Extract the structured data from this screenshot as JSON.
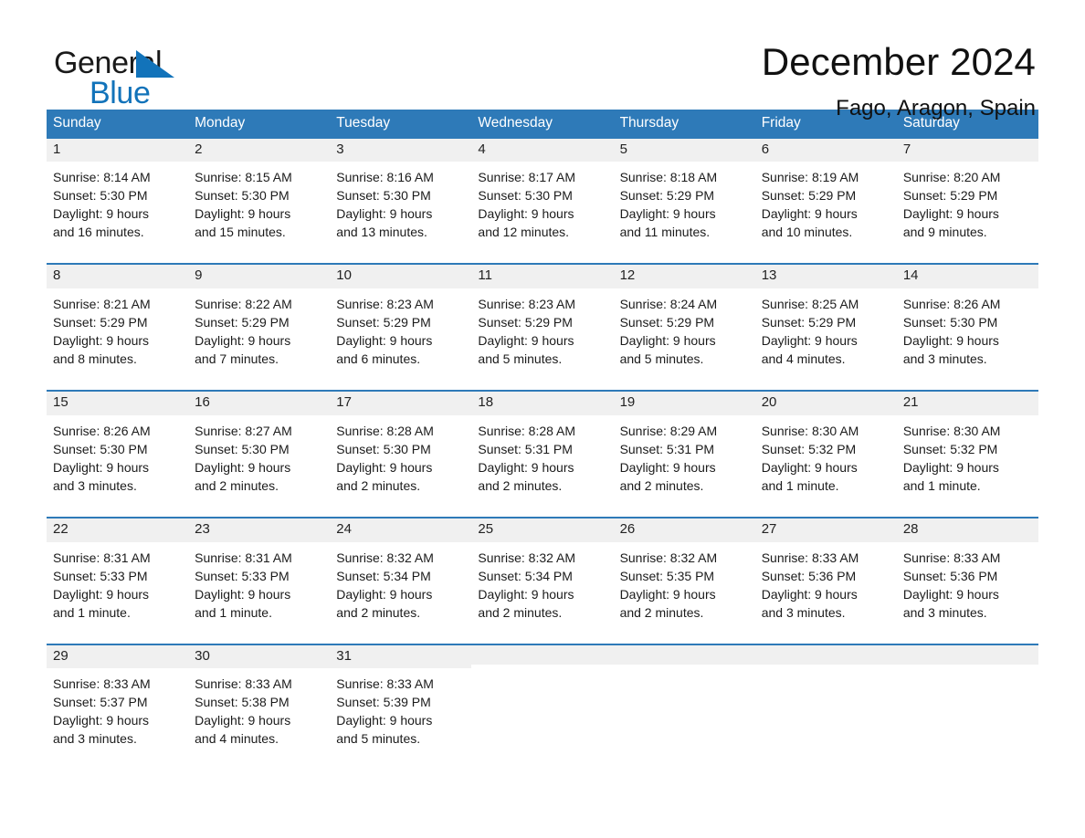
{
  "brand": {
    "word_general": "General",
    "word_blue": "Blue",
    "triangle_color": "#1273ba",
    "blue_text_color": "#1273ba"
  },
  "header": {
    "month_title": "December 2024",
    "location": "Fago, Aragon, Spain"
  },
  "theme": {
    "header_blue": "#2e7ab8",
    "day_band_gray": "#f0f0f0",
    "cell_white": "#ffffff",
    "text_black": "#1b1b1b"
  },
  "weekdays": [
    "Sunday",
    "Monday",
    "Tuesday",
    "Wednesday",
    "Thursday",
    "Friday",
    "Saturday"
  ],
  "weeks": [
    [
      {
        "day": "1",
        "sunrise": "Sunrise: 8:14 AM",
        "sunset": "Sunset: 5:30 PM",
        "daylight1": "Daylight: 9 hours",
        "daylight2": "and 16 minutes."
      },
      {
        "day": "2",
        "sunrise": "Sunrise: 8:15 AM",
        "sunset": "Sunset: 5:30 PM",
        "daylight1": "Daylight: 9 hours",
        "daylight2": "and 15 minutes."
      },
      {
        "day": "3",
        "sunrise": "Sunrise: 8:16 AM",
        "sunset": "Sunset: 5:30 PM",
        "daylight1": "Daylight: 9 hours",
        "daylight2": "and 13 minutes."
      },
      {
        "day": "4",
        "sunrise": "Sunrise: 8:17 AM",
        "sunset": "Sunset: 5:30 PM",
        "daylight1": "Daylight: 9 hours",
        "daylight2": "and 12 minutes."
      },
      {
        "day": "5",
        "sunrise": "Sunrise: 8:18 AM",
        "sunset": "Sunset: 5:29 PM",
        "daylight1": "Daylight: 9 hours",
        "daylight2": "and 11 minutes."
      },
      {
        "day": "6",
        "sunrise": "Sunrise: 8:19 AM",
        "sunset": "Sunset: 5:29 PM",
        "daylight1": "Daylight: 9 hours",
        "daylight2": "and 10 minutes."
      },
      {
        "day": "7",
        "sunrise": "Sunrise: 8:20 AM",
        "sunset": "Sunset: 5:29 PM",
        "daylight1": "Daylight: 9 hours",
        "daylight2": "and 9 minutes."
      }
    ],
    [
      {
        "day": "8",
        "sunrise": "Sunrise: 8:21 AM",
        "sunset": "Sunset: 5:29 PM",
        "daylight1": "Daylight: 9 hours",
        "daylight2": "and 8 minutes."
      },
      {
        "day": "9",
        "sunrise": "Sunrise: 8:22 AM",
        "sunset": "Sunset: 5:29 PM",
        "daylight1": "Daylight: 9 hours",
        "daylight2": "and 7 minutes."
      },
      {
        "day": "10",
        "sunrise": "Sunrise: 8:23 AM",
        "sunset": "Sunset: 5:29 PM",
        "daylight1": "Daylight: 9 hours",
        "daylight2": "and 6 minutes."
      },
      {
        "day": "11",
        "sunrise": "Sunrise: 8:23 AM",
        "sunset": "Sunset: 5:29 PM",
        "daylight1": "Daylight: 9 hours",
        "daylight2": "and 5 minutes."
      },
      {
        "day": "12",
        "sunrise": "Sunrise: 8:24 AM",
        "sunset": "Sunset: 5:29 PM",
        "daylight1": "Daylight: 9 hours",
        "daylight2": "and 5 minutes."
      },
      {
        "day": "13",
        "sunrise": "Sunrise: 8:25 AM",
        "sunset": "Sunset: 5:29 PM",
        "daylight1": "Daylight: 9 hours",
        "daylight2": "and 4 minutes."
      },
      {
        "day": "14",
        "sunrise": "Sunrise: 8:26 AM",
        "sunset": "Sunset: 5:30 PM",
        "daylight1": "Daylight: 9 hours",
        "daylight2": "and 3 minutes."
      }
    ],
    [
      {
        "day": "15",
        "sunrise": "Sunrise: 8:26 AM",
        "sunset": "Sunset: 5:30 PM",
        "daylight1": "Daylight: 9 hours",
        "daylight2": "and 3 minutes."
      },
      {
        "day": "16",
        "sunrise": "Sunrise: 8:27 AM",
        "sunset": "Sunset: 5:30 PM",
        "daylight1": "Daylight: 9 hours",
        "daylight2": "and 2 minutes."
      },
      {
        "day": "17",
        "sunrise": "Sunrise: 8:28 AM",
        "sunset": "Sunset: 5:30 PM",
        "daylight1": "Daylight: 9 hours",
        "daylight2": "and 2 minutes."
      },
      {
        "day": "18",
        "sunrise": "Sunrise: 8:28 AM",
        "sunset": "Sunset: 5:31 PM",
        "daylight1": "Daylight: 9 hours",
        "daylight2": "and 2 minutes."
      },
      {
        "day": "19",
        "sunrise": "Sunrise: 8:29 AM",
        "sunset": "Sunset: 5:31 PM",
        "daylight1": "Daylight: 9 hours",
        "daylight2": "and 2 minutes."
      },
      {
        "day": "20",
        "sunrise": "Sunrise: 8:30 AM",
        "sunset": "Sunset: 5:32 PM",
        "daylight1": "Daylight: 9 hours",
        "daylight2": "and 1 minute."
      },
      {
        "day": "21",
        "sunrise": "Sunrise: 8:30 AM",
        "sunset": "Sunset: 5:32 PM",
        "daylight1": "Daylight: 9 hours",
        "daylight2": "and 1 minute."
      }
    ],
    [
      {
        "day": "22",
        "sunrise": "Sunrise: 8:31 AM",
        "sunset": "Sunset: 5:33 PM",
        "daylight1": "Daylight: 9 hours",
        "daylight2": "and 1 minute."
      },
      {
        "day": "23",
        "sunrise": "Sunrise: 8:31 AM",
        "sunset": "Sunset: 5:33 PM",
        "daylight1": "Daylight: 9 hours",
        "daylight2": "and 1 minute."
      },
      {
        "day": "24",
        "sunrise": "Sunrise: 8:32 AM",
        "sunset": "Sunset: 5:34 PM",
        "daylight1": "Daylight: 9 hours",
        "daylight2": "and 2 minutes."
      },
      {
        "day": "25",
        "sunrise": "Sunrise: 8:32 AM",
        "sunset": "Sunset: 5:34 PM",
        "daylight1": "Daylight: 9 hours",
        "daylight2": "and 2 minutes."
      },
      {
        "day": "26",
        "sunrise": "Sunrise: 8:32 AM",
        "sunset": "Sunset: 5:35 PM",
        "daylight1": "Daylight: 9 hours",
        "daylight2": "and 2 minutes."
      },
      {
        "day": "27",
        "sunrise": "Sunrise: 8:33 AM",
        "sunset": "Sunset: 5:36 PM",
        "daylight1": "Daylight: 9 hours",
        "daylight2": "and 3 minutes."
      },
      {
        "day": "28",
        "sunrise": "Sunrise: 8:33 AM",
        "sunset": "Sunset: 5:36 PM",
        "daylight1": "Daylight: 9 hours",
        "daylight2": "and 3 minutes."
      }
    ],
    [
      {
        "day": "29",
        "sunrise": "Sunrise: 8:33 AM",
        "sunset": "Sunset: 5:37 PM",
        "daylight1": "Daylight: 9 hours",
        "daylight2": "and 3 minutes."
      },
      {
        "day": "30",
        "sunrise": "Sunrise: 8:33 AM",
        "sunset": "Sunset: 5:38 PM",
        "daylight1": "Daylight: 9 hours",
        "daylight2": "and 4 minutes."
      },
      {
        "day": "31",
        "sunrise": "Sunrise: 8:33 AM",
        "sunset": "Sunset: 5:39 PM",
        "daylight1": "Daylight: 9 hours",
        "daylight2": "and 5 minutes."
      },
      {
        "day": "",
        "sunrise": "",
        "sunset": "",
        "daylight1": "",
        "daylight2": ""
      },
      {
        "day": "",
        "sunrise": "",
        "sunset": "",
        "daylight1": "",
        "daylight2": ""
      },
      {
        "day": "",
        "sunrise": "",
        "sunset": "",
        "daylight1": "",
        "daylight2": ""
      },
      {
        "day": "",
        "sunrise": "",
        "sunset": "",
        "daylight1": "",
        "daylight2": ""
      }
    ]
  ]
}
